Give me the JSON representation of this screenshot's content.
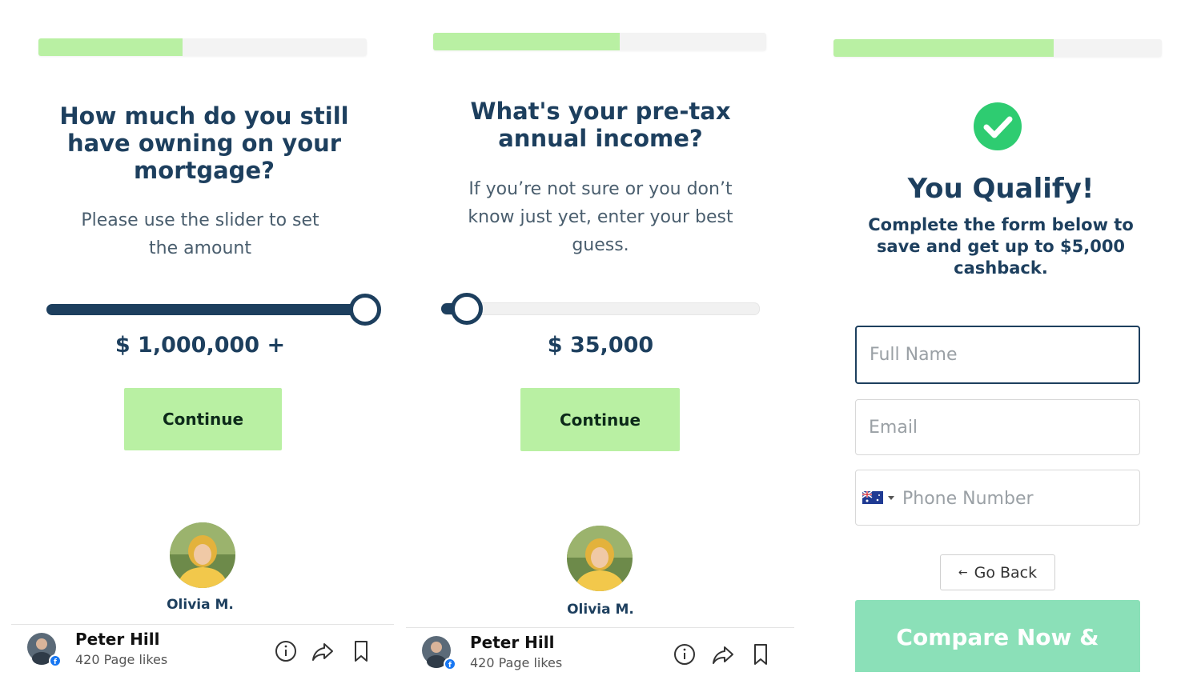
{
  "panel1": {
    "progress": 0.44,
    "title": "How much do you still have owning on your mortgage?",
    "subtitle": "Please use the slider to set the amount",
    "slider_value": 1.0,
    "amount": "$ 1,000,000 +",
    "continue_label": "Continue",
    "reviewer_name": "Olivia M.",
    "fb_name": "Peter Hill",
    "fb_likes": "420 Page likes"
  },
  "panel2": {
    "progress": 0.56,
    "title": "What's your pre-tax annual income?",
    "subtitle": "If you’re not sure or you don’t know just yet, enter your best guess.",
    "slider_value": 0.08,
    "amount": "$ 35,000",
    "continue_label": "Continue",
    "reviewer_name": "Olivia M.",
    "fb_name": "Peter Hill",
    "fb_likes": "420 Page likes"
  },
  "panel3": {
    "progress": 0.67,
    "title": "You Qualify!",
    "subtitle": "Complete the form below to save and get up to $5,000 cashback.",
    "full_name_placeholder": "Full Name",
    "email_placeholder": "Email",
    "phone_placeholder": "Phone Number",
    "country_flag_icon": "australia-flag-icon",
    "go_back_label": "Go Back",
    "compare_label": "Compare Now &"
  },
  "colors": {
    "navy": "#1d3f5e",
    "green_light": "#b9f0a3",
    "teal_button": "#8be0b8",
    "check_green": "#2ecc71"
  }
}
